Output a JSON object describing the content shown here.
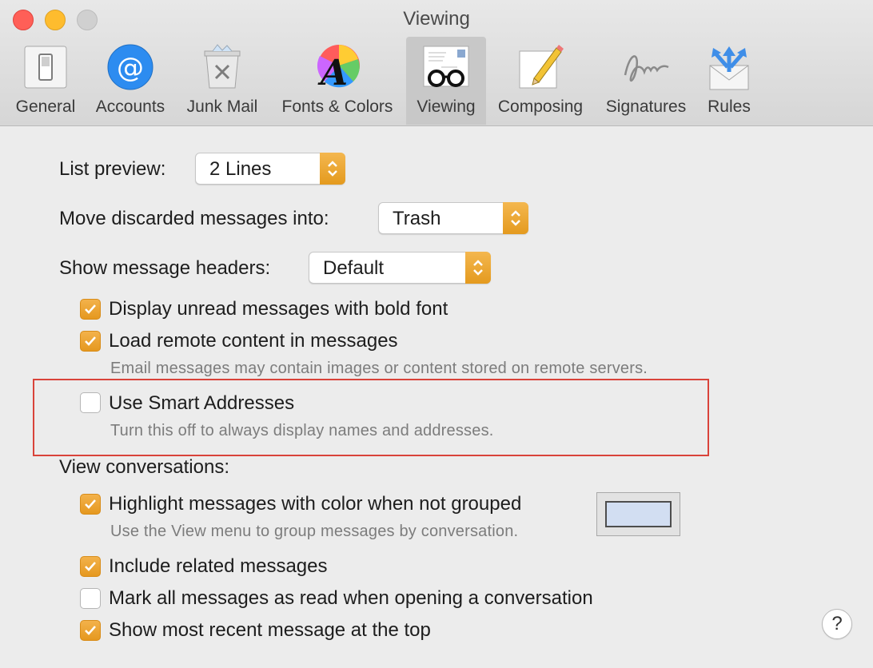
{
  "window": {
    "title": "Viewing"
  },
  "toolbar": {
    "tabs": [
      {
        "label": "General",
        "icon": "switch-icon"
      },
      {
        "label": "Accounts",
        "icon": "at-sign-icon"
      },
      {
        "label": "Junk Mail",
        "icon": "junk-trash-icon"
      },
      {
        "label": "Fonts & Colors",
        "icon": "font-color-wheel-icon"
      },
      {
        "label": "Viewing",
        "icon": "glasses-icon",
        "selected": true
      },
      {
        "label": "Composing",
        "icon": "pencil-paper-icon"
      },
      {
        "label": "Signatures",
        "icon": "signature-icon"
      },
      {
        "label": "Rules",
        "icon": "rules-envelope-icon"
      }
    ]
  },
  "settings": {
    "list_preview": {
      "label": "List preview:",
      "value": "2 Lines"
    },
    "move_discarded": {
      "label": "Move discarded messages into:",
      "value": "Trash"
    },
    "message_headers": {
      "label": "Show message headers:",
      "value": "Default"
    },
    "display_unread_bold": {
      "label": "Display unread messages with bold font",
      "checked": true
    },
    "load_remote": {
      "label": "Load remote content in messages",
      "checked": true,
      "hint": "Email messages may contain images or content stored on remote servers."
    },
    "smart_addresses": {
      "label": "Use Smart Addresses",
      "checked": false,
      "hint": "Turn this off to always display names and addresses."
    },
    "view_conversations": {
      "label": "View conversations:"
    },
    "highlight_color": {
      "label": "Highlight messages with color when not grouped",
      "checked": true,
      "hint": "Use the View menu to group messages by conversation.",
      "color": "#d2def2"
    },
    "include_related": {
      "label": "Include related messages",
      "checked": true
    },
    "mark_all_read": {
      "label": "Mark all messages as read when opening a conversation",
      "checked": false
    },
    "recent_top": {
      "label": "Show most recent message at the top",
      "checked": true
    }
  },
  "help": {
    "label": "?"
  },
  "colors": {
    "accent": "#e9a02c",
    "annotation": "#d9433a"
  }
}
